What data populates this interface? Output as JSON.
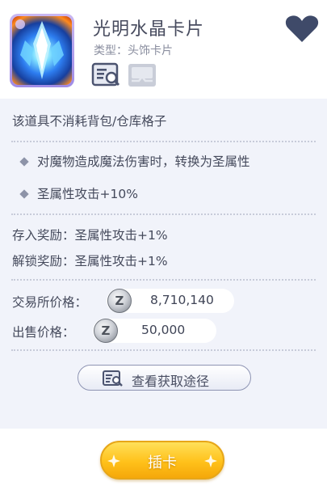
{
  "header": {
    "title": "光明水晶卡片",
    "subtitle": "类型：头饰卡片"
  },
  "panel": {
    "storage_note": "该道具不消耗背包/仓库格子",
    "effects": [
      "对魔物造成魔法伤害时，转换为圣属性",
      "圣属性攻击+10%"
    ],
    "deposit_reward": "存入奖励：圣属性攻击+1%",
    "unlock_reward": "解锁奖励：圣属性攻击+1%",
    "exchange_price_label": "交易所价格：",
    "exchange_price_value": "8,710,140",
    "sell_price_label": "出售价格：",
    "sell_price_value": "50,000",
    "coin_symbol": "Z",
    "view_source_label": "查看获取途径"
  },
  "footer": {
    "insert_label": "插卡"
  },
  "colors": {
    "panel_bg": "#f1f3fa",
    "accent_yellow": "#ffc11a",
    "heart": "#3f4a69"
  },
  "icons": [
    "card-image-icon",
    "heart-icon",
    "inspect-icon",
    "box-icon",
    "diamond-bullet-icon",
    "zeny-coin-icon",
    "sparkle-icon"
  ]
}
